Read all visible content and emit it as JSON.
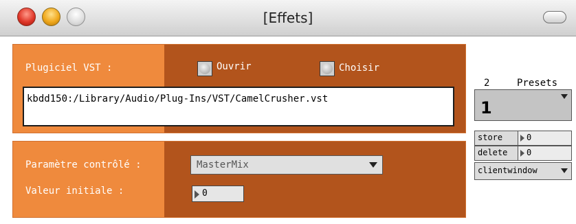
{
  "window": {
    "title": "[Effets]"
  },
  "plugin_section": {
    "label": "Plugiciel VST :",
    "open_button": "Ouvrir",
    "choose_button": "Choisir",
    "path": "kbdd150:/Library/Audio/Plug-Ins/VST/CamelCrusher.vst"
  },
  "param_section": {
    "controlled_param_label": "Paramètre contrôlé :",
    "controlled_param_value": "MasterMix",
    "initial_value_label": "Valeur initiale :",
    "initial_value": "0"
  },
  "presets": {
    "count": "2",
    "title": "Presets",
    "current": "1",
    "store_label": "store",
    "store_value": "0",
    "delete_label": "delete",
    "delete_value": "0",
    "client_window": "clientwindow"
  },
  "colors": {
    "panel_light": "#ef8a3d",
    "panel_dark": "#b2541c"
  }
}
